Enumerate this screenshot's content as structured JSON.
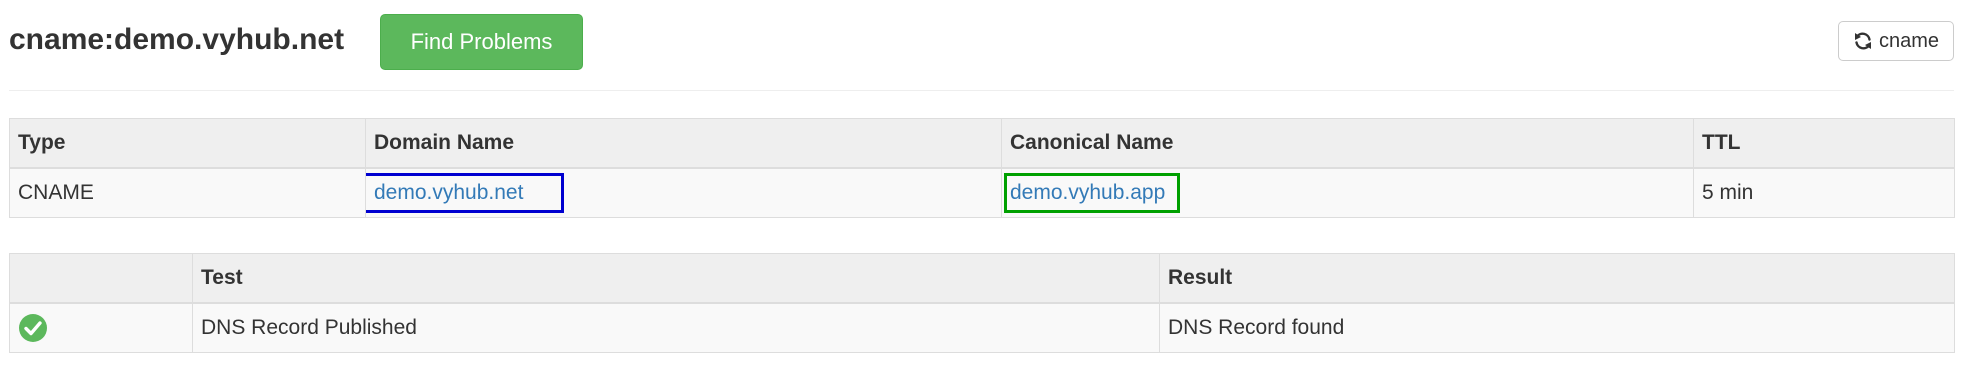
{
  "header": {
    "title": "cname:demo.vyhub.net",
    "find_problems_label": "Find Problems",
    "refresh_label": "cname"
  },
  "records_table": {
    "columns": [
      "Type",
      "Domain Name",
      "Canonical Name",
      "TTL"
    ],
    "rows": [
      {
        "type": "CNAME",
        "domain_name": "demo.vyhub.net",
        "canonical_name": "demo.vyhub.app",
        "ttl": "5 min"
      }
    ]
  },
  "tests_table": {
    "columns": [
      "",
      "Test",
      "Result"
    ],
    "rows": [
      {
        "status_icon": "check-circle-icon",
        "test": "DNS Record Published",
        "result": "DNS Record found"
      }
    ]
  },
  "colors": {
    "success": "#5cb85c",
    "link": "#337ab7",
    "highlight_domain": "#0000d0",
    "highlight_canonical": "#00a000"
  }
}
